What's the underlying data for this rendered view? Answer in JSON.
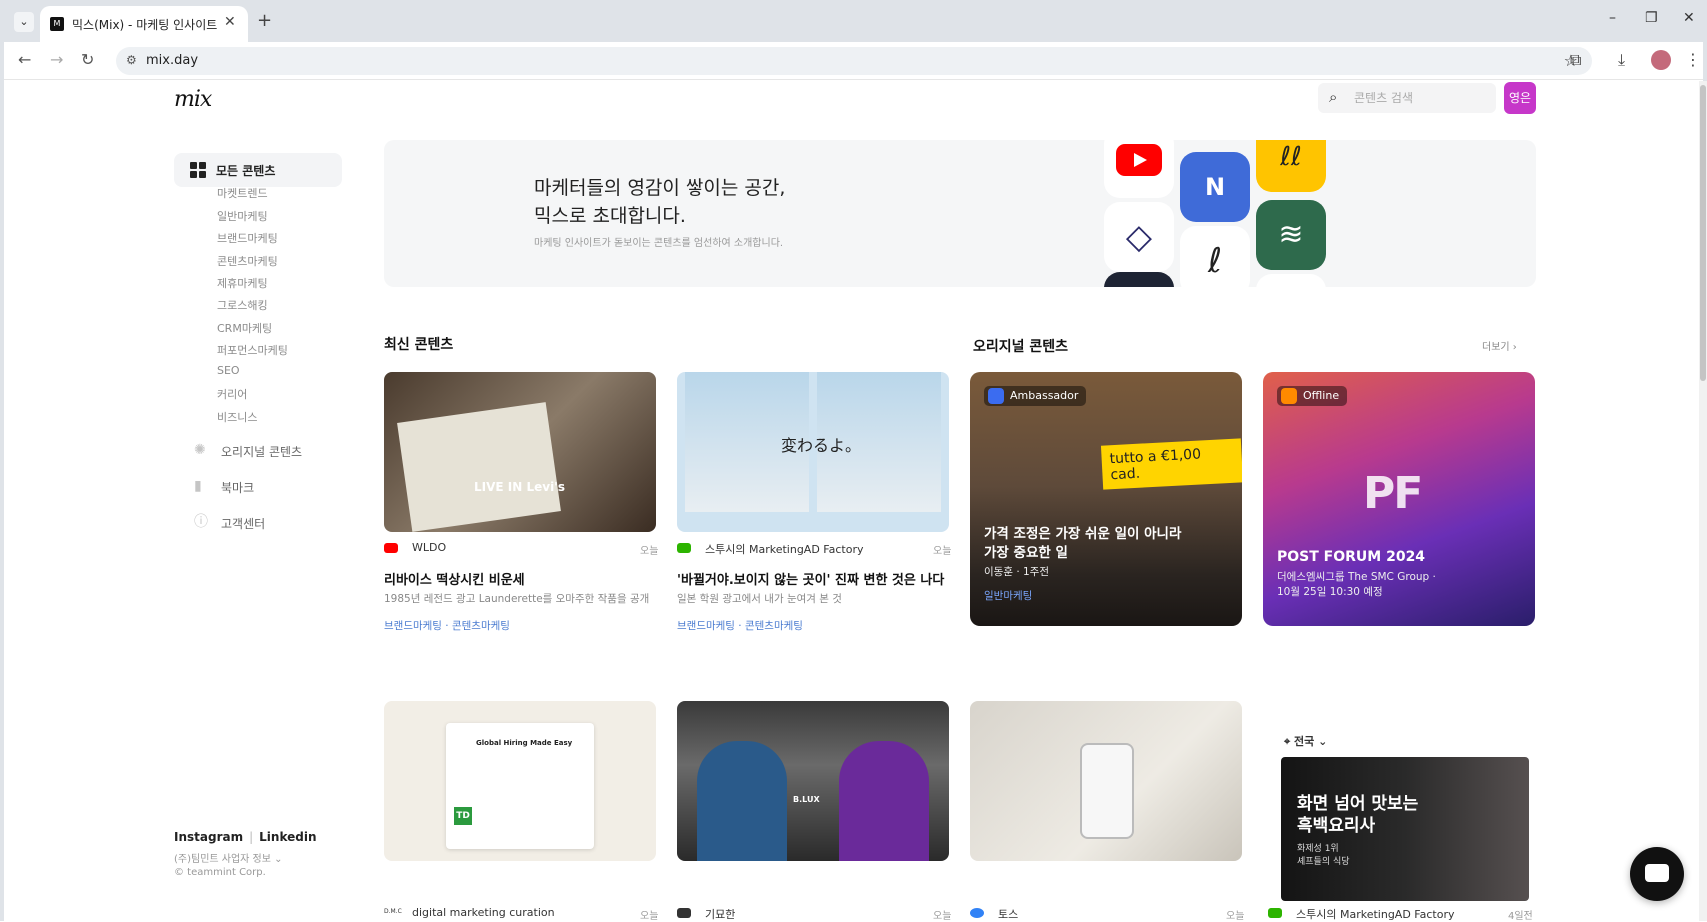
{
  "browser": {
    "tab_title": "믹스(Mix) - 마케팅 인사이트 🗋",
    "url": "mix.day",
    "tab_menu_icon": "chevron-down",
    "new_tab_icon": "+",
    "win_min": "–",
    "win_restore": "❐",
    "win_close": "✕"
  },
  "header": {
    "logo": "mix",
    "search_placeholder": "콘텐츠 검색",
    "avatar_text": "영은"
  },
  "sidebar": {
    "all_contents": "모든 콘텐츠",
    "categories": [
      "마켓트렌드",
      "일반마케팅",
      "브랜드마케팅",
      "콘텐츠마케팅",
      "제휴마케팅",
      "그로스해킹",
      "CRM마케팅",
      "퍼포먼스마케팅",
      "SEO",
      "커리어",
      "비즈니스"
    ],
    "original": "오리지널 콘텐츠",
    "bookmark": "북마크",
    "help": "고객센터",
    "instagram": "Instagram",
    "linkedin": "Linkedin",
    "biz_info": "(주)팀민트 사업자 정보",
    "copyright": "© teammint Corp."
  },
  "hero": {
    "title": "마케터들의 영감이 쌓이는 공간,\n믹스로 초대합니다.",
    "subtitle": "마케팅 인사이트가 돋보이는 콘텐츠를 엄선하여 소개합니다."
  },
  "sections": {
    "latest": "최신 콘텐츠",
    "original": "오리지널 콘텐츠",
    "more": "더보기"
  },
  "latest_cards": [
    {
      "source": "WLDO",
      "date": "오늘",
      "title": "리바이스 떡상시킨 비운세",
      "desc": "1985년 레전드 광고 Launderette를 오마주한 작품을 공개",
      "tags": "브랜드마케팅 · 콘텐츠마케팅",
      "img_caption": "LIVE IN Levi's",
      "source_color": "#ff0000"
    },
    {
      "source": "스투시의 MarketingAD Factory",
      "date": "오늘",
      "title": "'바뀔거야.보이지 않는 곳이' 진짜 변한 것은 나다",
      "desc": "일본 학원 광고에서 내가 눈여겨 본 것",
      "tags": "브랜드마케팅 · 콘텐츠마케팅",
      "img_caption": "変わるよ。",
      "source_color": "#2db400"
    }
  ],
  "original_cards": [
    {
      "badge": "Ambassador",
      "title": "가격 조정은 가장 쉬운 일이 아니라\n가장 중요한 일",
      "meta": "이동훈 · 1주전",
      "tag": "일반마케팅",
      "price_sign": "tutto a €1,00 cad."
    },
    {
      "badge": "Offline",
      "title": "POST FORUM 2024",
      "meta": "더에스엠씨그룹 The SMC Group ·\n10월 25일 10:30 예정",
      "tag": "",
      "logo": "PF"
    }
  ],
  "bottom_cards": [
    {
      "source": "digital marketing curation",
      "date": "오늘",
      "src_label": "D.M.C",
      "img_text": "Global Hiring Made Easy"
    },
    {
      "source": "기묘한",
      "date": "오늘",
      "img_text": "B.LUX"
    },
    {
      "source": "토스",
      "date": "오늘"
    },
    {
      "source": "스투시의 MarketingAD Factory",
      "date": "4일전",
      "img_title": "화면 넘어 맛보는\n흑백요리사",
      "img_sub": "화제성 1위\n셰프들의 식당"
    }
  ],
  "region": "전국",
  "colors": {
    "accent_blue": "#4a7bd0",
    "avatar": "#c637c9"
  }
}
